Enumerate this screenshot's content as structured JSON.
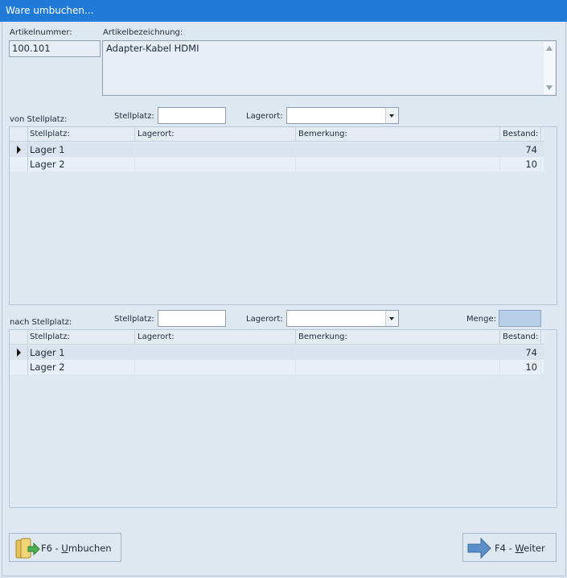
{
  "window": {
    "title": "Ware umbuchen..."
  },
  "artikel": {
    "nummer_label": "Artikelnummer:",
    "nummer_value": "100.101",
    "bezeichnung_label": "Artikelbezeichnung:",
    "bezeichnung_value": "Adapter-Kabel HDMI"
  },
  "von": {
    "section_label": "von Stellplatz:",
    "stellplatz_label": "Stellplatz:",
    "stellplatz_value": "",
    "lagerort_label": "Lagerort:",
    "lagerort_value": "",
    "columns": [
      "Stellplatz:",
      "Lagerort:",
      "Bemerkung:",
      "Bestand:"
    ],
    "rows": [
      {
        "stellplatz": "Lager 1",
        "lagerort": "",
        "bemerkung": "",
        "bestand": "74"
      },
      {
        "stellplatz": "Lager 2",
        "lagerort": "",
        "bemerkung": "",
        "bestand": "10"
      }
    ]
  },
  "nach": {
    "section_label": "nach Stellplatz:",
    "stellplatz_label": "Stellplatz:",
    "stellplatz_value": "",
    "lagerort_label": "Lagerort:",
    "lagerort_value": "",
    "menge_label": "Menge:",
    "menge_value": "",
    "columns": [
      "Stellplatz:",
      "Lagerort:",
      "Bemerkung:",
      "Bestand:"
    ],
    "rows": [
      {
        "stellplatz": "Lager 1",
        "lagerort": "",
        "bemerkung": "",
        "bestand": "74"
      },
      {
        "stellplatz": "Lager 2",
        "lagerort": "",
        "bemerkung": "",
        "bestand": "10"
      }
    ]
  },
  "buttons": {
    "umbuchen_prefix": "F6 - ",
    "umbuchen_key": "U",
    "umbuchen_rest": "mbuchen",
    "weiter_prefix": "F4 - ",
    "weiter_key": "W",
    "weiter_rest": "eiter"
  },
  "colors": {
    "titlebar": "#1f7ad8",
    "background": "#dfe8f1",
    "menge_field": "#b8cfe9"
  }
}
